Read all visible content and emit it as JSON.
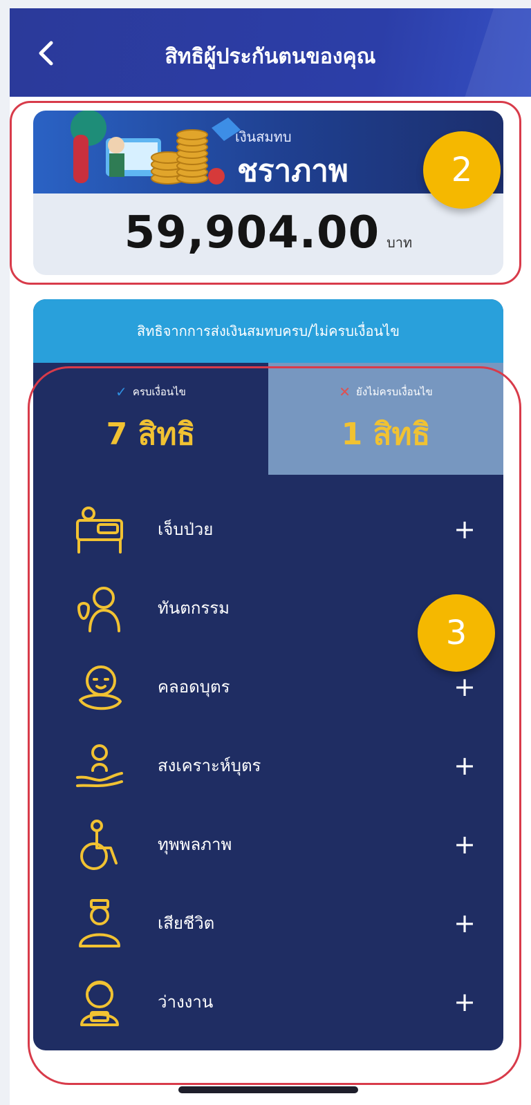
{
  "header": {
    "title": "สิทธิผู้ประกันตนของคุณ",
    "back_icon": "chevron-left-icon"
  },
  "summary": {
    "caption": "เงินสมทบ",
    "fund_name": "ชราภาพ",
    "amount": "59,904.00",
    "unit": "บาท"
  },
  "badges": [
    "2",
    "3"
  ],
  "rights": {
    "banner": "สิทธิจากการส่งเงินสมทบครบ/ไม่ครบเงื่อนไข",
    "tabs": [
      {
        "status": "ครบเงื่อนไข",
        "count": "7 สิทธิ",
        "icon": "check-icon"
      },
      {
        "status": "ยังไม่ครบเงื่อนไข",
        "count": "1 สิทธิ",
        "icon": "cross-icon"
      }
    ],
    "items": [
      {
        "label": "เจ็บป่วย",
        "icon": "hospital-bed-icon",
        "action": "+"
      },
      {
        "label": "ทันตกรรม",
        "icon": "dentist-icon",
        "action": ""
      },
      {
        "label": "คลอดบุตร",
        "icon": "baby-icon",
        "action": "+"
      },
      {
        "label": "สงเคราะห์บุตร",
        "icon": "child-care-icon",
        "action": "+"
      },
      {
        "label": "ทุพพลภาพ",
        "icon": "wheelchair-icon",
        "action": "+"
      },
      {
        "label": "เสียชีวิต",
        "icon": "deceased-person-icon",
        "action": "+"
      },
      {
        "label": "ว่างงาน",
        "icon": "unemployed-icon",
        "action": "+"
      }
    ]
  },
  "colors": {
    "header": "#2c3ea8",
    "card_dark": "#1f2d63",
    "banner": "#29a0db",
    "tab_inactive": "#7797c0",
    "gold": "#f1c232",
    "badge": "#f5b800",
    "outline": "#d83b4a"
  }
}
